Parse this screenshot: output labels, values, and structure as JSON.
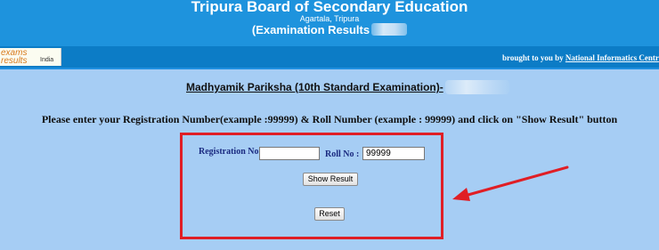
{
  "header": {
    "title": "Tripura Board of Secondary Education",
    "subtitle": "Agartala, Tripura",
    "results": "(Examination Results"
  },
  "band": {
    "logo": {
      "line1": "exams",
      "line2": "results",
      "country": "India"
    },
    "brought_by": "brought to you by",
    "provider": "National Informatics Centr"
  },
  "main": {
    "exam_title": "Madhyamik Pariksha (10th Standard Examination)-",
    "instruction": "Please enter your Registration Number(example :99999) & Roll Number (example : 99999) and click on \"Show Result\" button"
  },
  "form": {
    "registration_label": "Registration No  :",
    "registration_value": "",
    "roll_label": "Roll No  :",
    "roll_value": "99999",
    "show_button": "Show Result",
    "reset_button": "Reset"
  },
  "colors": {
    "background": "#a6cdf4",
    "header": "#1e93dd",
    "band": "#0c7cc6",
    "annotation_red": "#e01e25"
  },
  "icons": {
    "annotation": "red-arrow-icon"
  }
}
